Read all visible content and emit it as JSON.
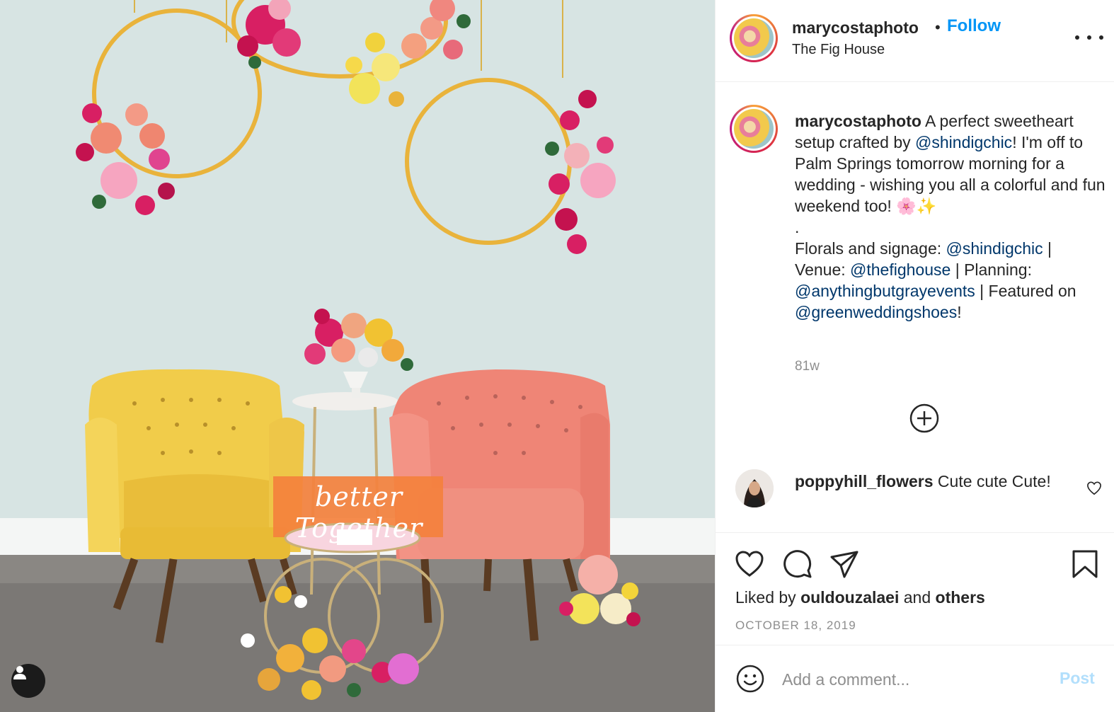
{
  "post": {
    "author": "marycostaphoto",
    "separator": "•",
    "follow_label": "Follow",
    "location": "The Fig House",
    "image_text": "better Together"
  },
  "caption": {
    "username": "marycostaphoto",
    "text_1": " A perfect sweetheart setup crafted by ",
    "mention_1": "@shindigchic",
    "text_2": "! I'm off to Palm Springs tomorrow morning for a wedding - wishing you all a colorful and fun weekend too! 🌸✨",
    "dot_line": ".",
    "text_3": "Florals and signage: ",
    "mention_2": "@shindigchic",
    "text_4": " | Venue: ",
    "mention_3": "@thefighouse",
    "text_5": " | Planning: ",
    "mention_4": "@anythingbutgrayevents",
    "text_6": " | Featured on ",
    "mention_5": "@greenweddingshoes",
    "text_7": "!",
    "time_ago": "81w"
  },
  "comments": [
    {
      "username": "poppyhill_flowers",
      "text": " Cute cute Cute!"
    }
  ],
  "likes": {
    "prefix": "Liked by ",
    "user": "ouldouzalaei",
    "middle": " and ",
    "others": "others"
  },
  "date": "OCTOBER 18, 2019",
  "add_comment": {
    "placeholder": "Add a comment...",
    "post_label": "Post"
  },
  "icons": {
    "more": "more-options-icon",
    "load_more": "plus-circle-icon",
    "like": "heart-icon",
    "comment": "comment-bubble-icon",
    "share": "paper-plane-icon",
    "save": "bookmark-icon",
    "emoji": "smiley-icon",
    "tag": "user-tag-icon"
  },
  "colors": {
    "link_blue": "#0095f6",
    "mention": "#00376b",
    "muted": "#8e8e8e",
    "post_disabled": "#b2dffc"
  }
}
